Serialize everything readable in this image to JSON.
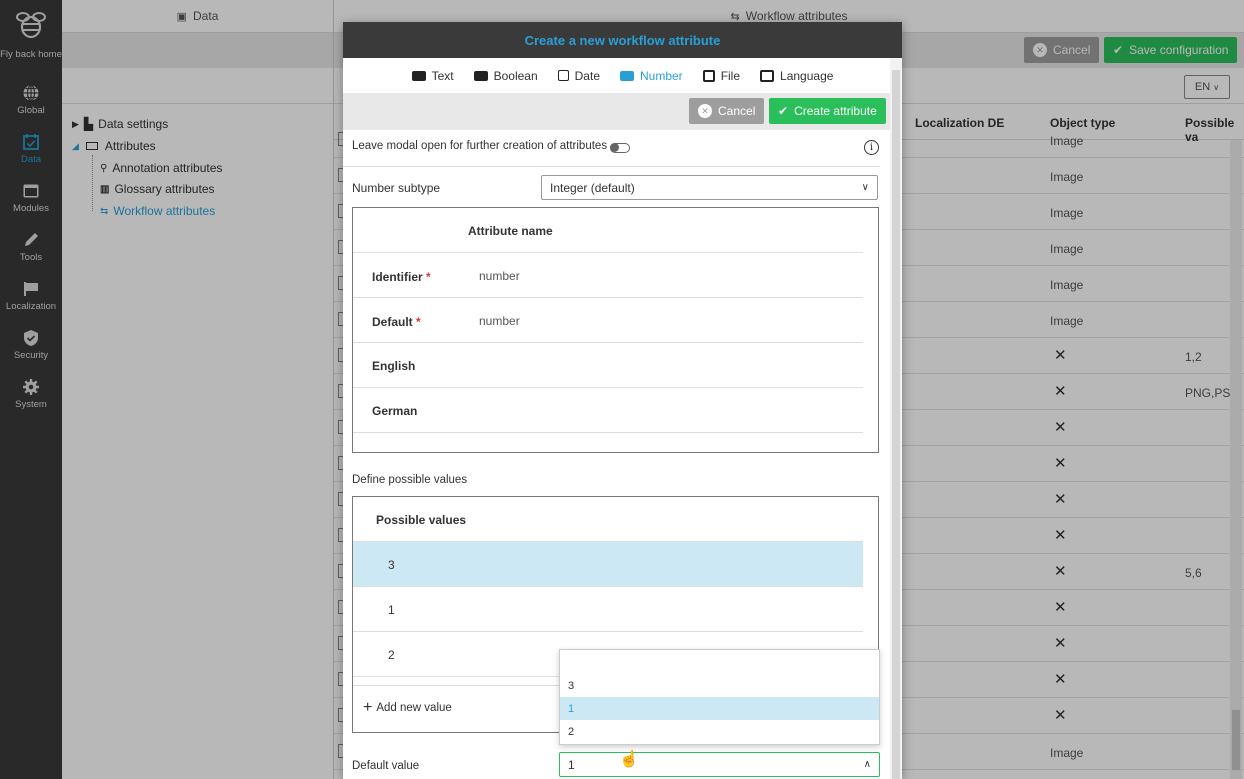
{
  "sidebar": {
    "logo_label": "Fly back home",
    "items": [
      {
        "label": "Global",
        "icon": "globe-icon"
      },
      {
        "label": "Data",
        "icon": "calendar-icon",
        "active": true
      },
      {
        "label": "Modules",
        "icon": "window-icon"
      },
      {
        "label": "Tools",
        "icon": "pencil-icon"
      },
      {
        "label": "Localization",
        "icon": "flag-icon"
      },
      {
        "label": "Security",
        "icon": "shield-icon"
      },
      {
        "label": "System",
        "icon": "gear-icon"
      }
    ]
  },
  "tree": {
    "header": "Data",
    "items": [
      {
        "label": "Data settings"
      },
      {
        "label": "Attributes"
      },
      {
        "label": "Annotation attributes"
      },
      {
        "label": "Glossary attributes"
      },
      {
        "label": "Workflow attributes",
        "active": true
      }
    ]
  },
  "main": {
    "header": "Workflow attributes",
    "cancel_label": "Cancel",
    "save_label": "Save configuration",
    "lang": "EN",
    "columns": [
      "Localization DE",
      "Object type",
      "Possible va"
    ],
    "rows": [
      {
        "object_type": "Image",
        "possible": ""
      },
      {
        "object_type": "Image",
        "possible": ""
      },
      {
        "object_type": "Image",
        "possible": ""
      },
      {
        "object_type": "Image",
        "possible": ""
      },
      {
        "object_type": "Image",
        "possible": ""
      },
      {
        "object_type": "Image",
        "possible": ""
      },
      {
        "object_type": "✕",
        "possible": "1,2"
      },
      {
        "object_type": "✕",
        "possible": "PNG,PSD"
      },
      {
        "object_type": "✕",
        "possible": ""
      },
      {
        "object_type": "✕",
        "possible": ""
      },
      {
        "object_type": "✕",
        "possible": ""
      },
      {
        "object_type": "✕",
        "possible": ""
      },
      {
        "object_type": "✕",
        "possible": "5,6"
      },
      {
        "object_type": "✕",
        "possible": ""
      },
      {
        "object_type": "✕",
        "possible": ""
      },
      {
        "object_type": "✕",
        "possible": ""
      },
      {
        "object_type": "✕",
        "possible": ""
      },
      {
        "object_type": "Image",
        "possible": ""
      }
    ]
  },
  "modal": {
    "title": "Create a new workflow attribute",
    "tabs": [
      "Text",
      "Boolean",
      "Date",
      "Number",
      "File",
      "Language"
    ],
    "active_tab": "Number",
    "cancel_label": "Cancel",
    "create_label": "Create attribute",
    "leave_open_label": "Leave modal open for further creation of attributes",
    "number_subtype_label": "Number subtype",
    "number_subtype_value": "Integer (default)",
    "attr_table_header": "Attribute name",
    "identifier_label": "Identifier",
    "identifier_value": "number",
    "default_label": "Default",
    "default_value_text": "number",
    "english_label": "English",
    "german_label": "German",
    "possible_values_section": "Define possible values",
    "possible_values_header": "Possible values",
    "possible_values": [
      "3",
      "1",
      "2"
    ],
    "add_new_value": "Add new value",
    "default_value_label": "Default value",
    "default_value_input": "1",
    "dropdown_options": [
      "3",
      "1",
      "2"
    ],
    "dropdown_selected": "1"
  }
}
